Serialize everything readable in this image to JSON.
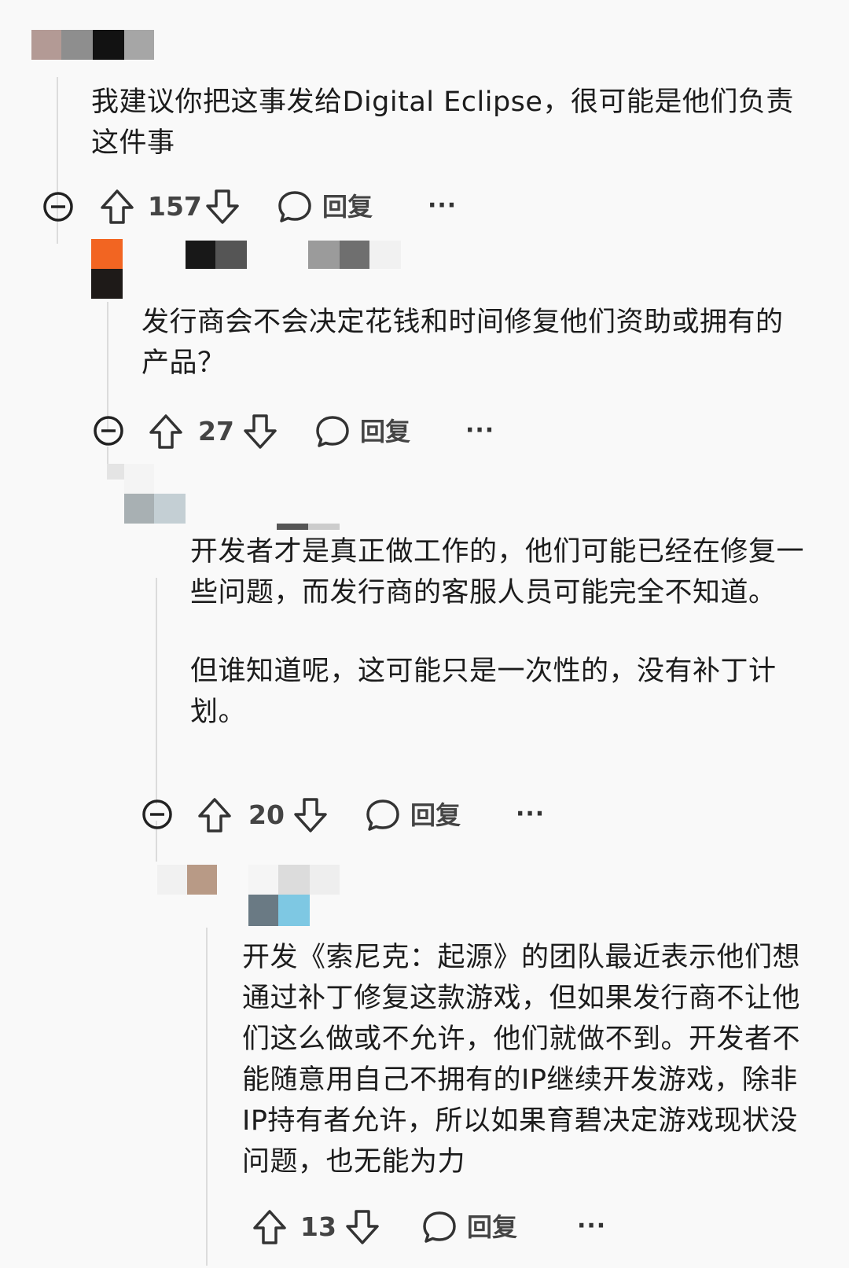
{
  "comments": [
    {
      "paragraphs": [
        "我建议你把这事发给Digital Eclipse，很可能是他们负责这件事"
      ],
      "votes": "157",
      "reply_label": "回复"
    },
    {
      "paragraphs": [
        "发行商会不会决定花钱和时间修复他们资助或拥有的产品？"
      ],
      "votes": "27",
      "reply_label": "回复"
    },
    {
      "paragraphs": [
        "开发者才是真正做工作的，他们可能已经在修复一些问题，而发行商的客服人员可能完全不知道。",
        "但谁知道呢，这可能只是一次性的，没有补丁计划。"
      ],
      "votes": "20",
      "reply_label": "回复"
    },
    {
      "paragraphs": [
        "开发《索尼克：起源》的团队最近表示他们想通过补丁修复这款游戏，但如果发行商不让他们这么做或不允许，他们就做不到。开发者不能随意用自己不拥有的IP继续开发游戏，除非IP持有者允许，所以如果育碧决定游戏现状没问题，也无能为力"
      ],
      "votes": "13",
      "reply_label": "回复"
    }
  ],
  "icons": {
    "collapse": "minus-circle-icon",
    "upvote": "arrow-up-icon",
    "downvote": "arrow-down-icon",
    "reply": "chat-bubble-icon",
    "more": "ellipsis-icon"
  },
  "colors": {
    "background": "#f9f9f9",
    "text": "#1c1c1c",
    "thread_line": "#dcdcdc"
  }
}
